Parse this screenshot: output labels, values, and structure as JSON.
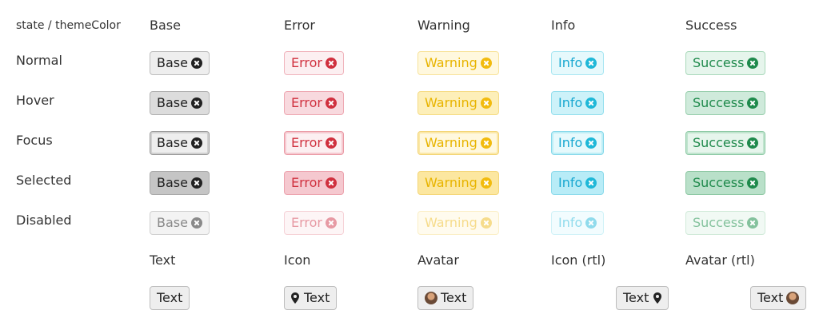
{
  "corner_label": "state / themeColor",
  "columns": [
    "Base",
    "Error",
    "Warning",
    "Info",
    "Success"
  ],
  "rows": [
    "Normal",
    "Hover",
    "Focus",
    "Selected",
    "Disabled"
  ],
  "chip_labels": {
    "base": "Base",
    "error": "Error",
    "warning": "Warning",
    "info": "Info",
    "success": "Success"
  },
  "variant_headers": [
    "Text",
    "Icon",
    "Avatar",
    "Icon (rtl)",
    "Avatar (rtl)"
  ],
  "variant_chips": {
    "text": "Text",
    "icon": "Text",
    "avatar": "Text",
    "icon_rtl": "Text",
    "avatar_rtl": "Text"
  },
  "icons": {
    "remove": "close-circle-icon",
    "location": "map-pin-icon",
    "avatar": "user-avatar"
  },
  "colors": {
    "base": "#222222",
    "error": "#d0313f",
    "warning": "#e8b400",
    "info": "#17a7d0",
    "success": "#1f8a4c"
  }
}
